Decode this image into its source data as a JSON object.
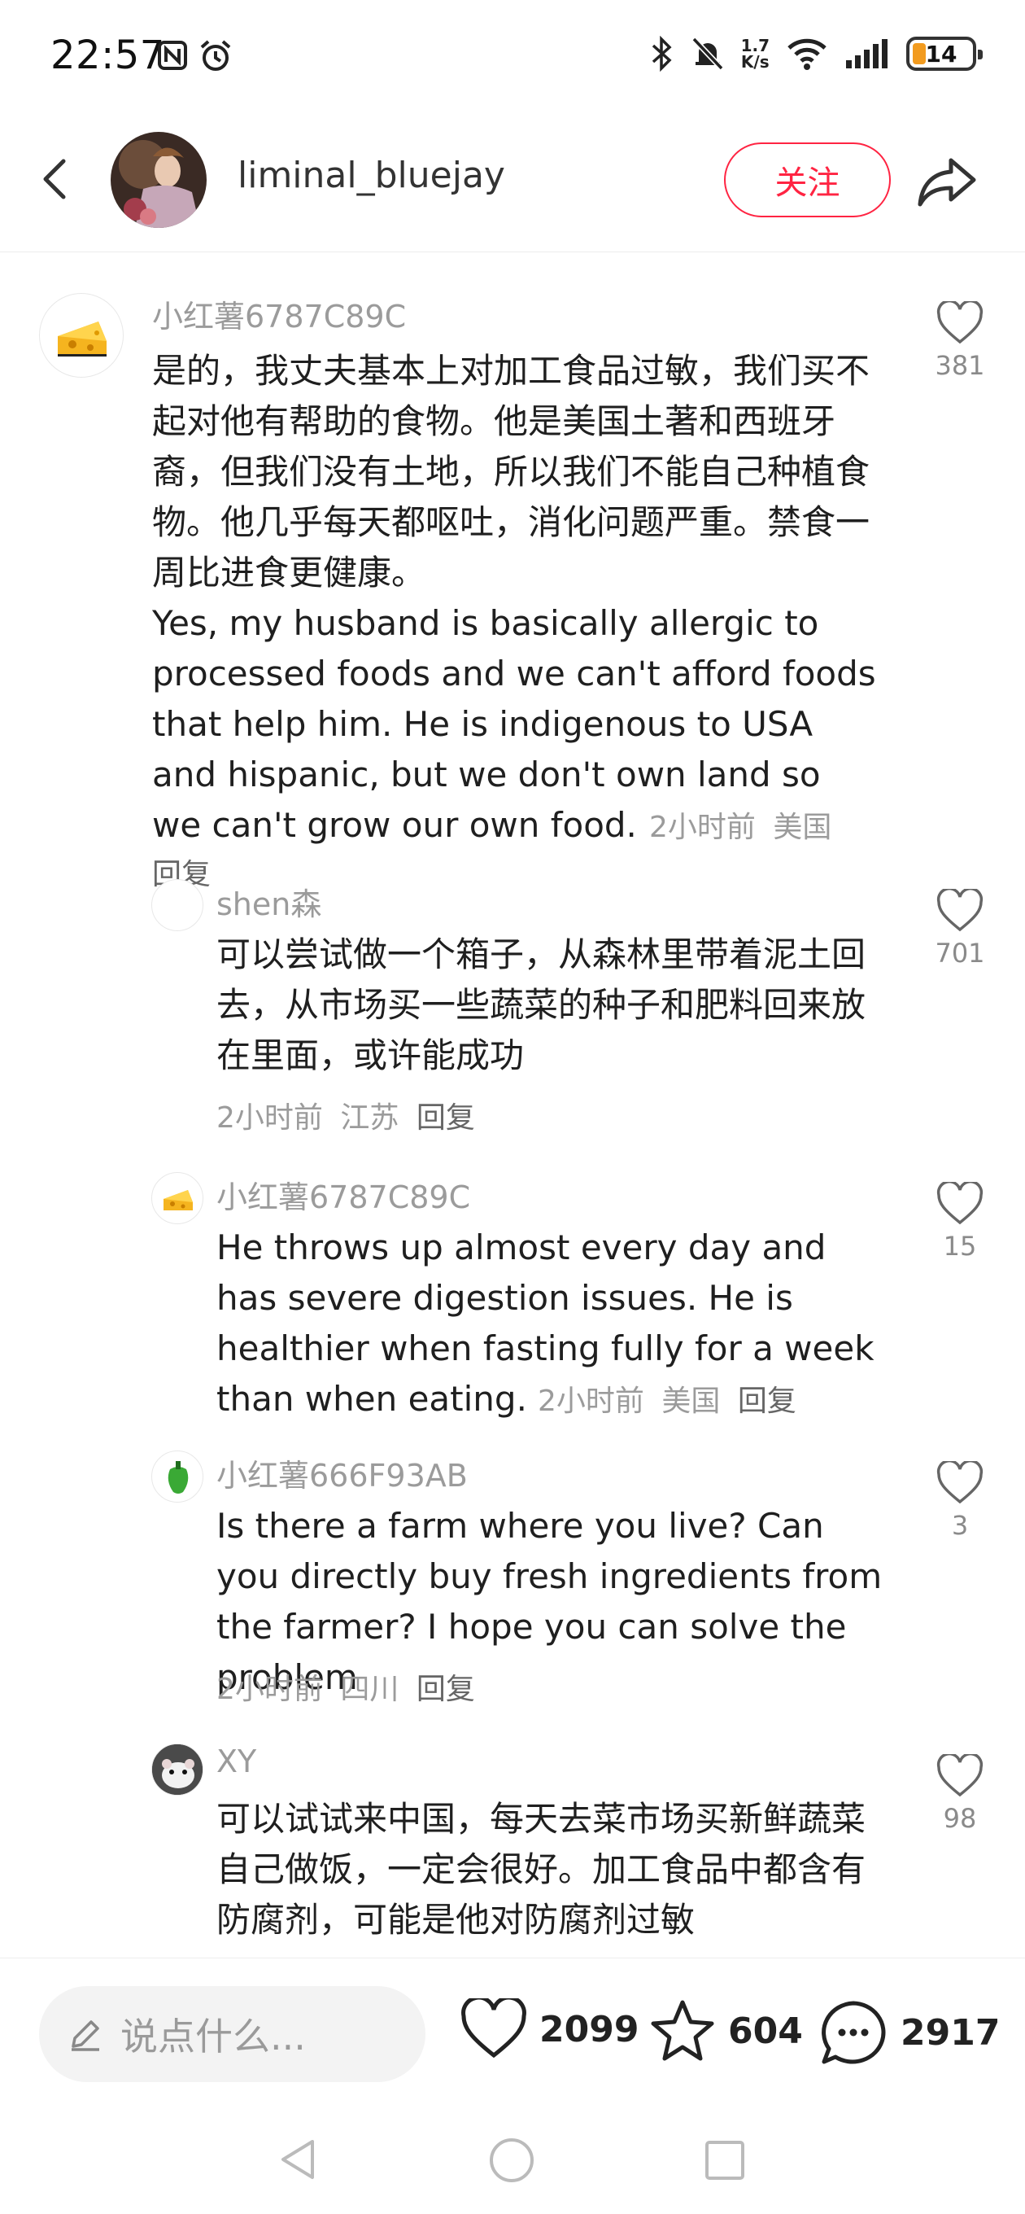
{
  "status_bar": {
    "time": "22:57",
    "net_speed_top": "1.7",
    "net_speed_bottom": "K/s",
    "battery": "14"
  },
  "header": {
    "username": "liminal_bluejay",
    "follow_label": "关注"
  },
  "comments": [
    {
      "author": "小红薯6787C89C",
      "text": "是的，我丈夫基本上对加工食品过敏，我们买不起对他有帮助的食物。他是美国土著和西班牙裔，但我们没有土地，所以我们不能自己种植食物。他几乎每天都呕吐，消化问题严重。禁食一周比进食更健康。\nYes, my husband is basically allergic to processed foods and we can't afford foods that help him. He is indigenous to USA and hispanic, but we don't own land so we can't grow our own food.",
      "time": "2小时前",
      "location": "美国",
      "reply": "回复",
      "likes": "381"
    },
    {
      "author": "shen森",
      "text": "可以尝试做一个箱子，从森林里带着泥土回去，从市场买一些蔬菜的种子和肥料回来放在里面，或许能成功",
      "time": "2小时前",
      "location": "江苏",
      "reply": "回复",
      "likes": "701"
    },
    {
      "author": "小红薯6787C89C",
      "text": "He throws up almost every day and has severe digestion issues. He is healthier when fasting fully for a week than when eating.",
      "time": "2小时前",
      "location": "美国",
      "reply": "回复",
      "likes": "15"
    },
    {
      "author": "小红薯666F93AB",
      "text": "Is there a farm where you live? Can you directly buy fresh ingredients from the farmer? I hope you can solve the problem",
      "time": "2小时前",
      "location": "四川",
      "reply": "回复",
      "likes": "3"
    },
    {
      "author": "XY",
      "text": "可以试试来中国，每天去菜市场买新鲜蔬菜自己做饭，一定会很好。加工食品中都含有防腐剂，可能是他对防腐剂过敏",
      "likes": "98"
    }
  ],
  "bottom_bar": {
    "input_placeholder": "说点什么...",
    "likes": "2099",
    "stars": "604",
    "comments": "2917"
  },
  "colors": {
    "accent": "#ff2442",
    "meta_gray": "#9b9b9b",
    "battery_fill": "#f29b1f"
  },
  "icons": [
    "back-arrow-icon",
    "share-icon",
    "heart-icon",
    "star-icon",
    "chat-bubble-icon",
    "pencil-icon",
    "nav-back-icon",
    "nav-home-icon",
    "nav-recents-icon"
  ]
}
